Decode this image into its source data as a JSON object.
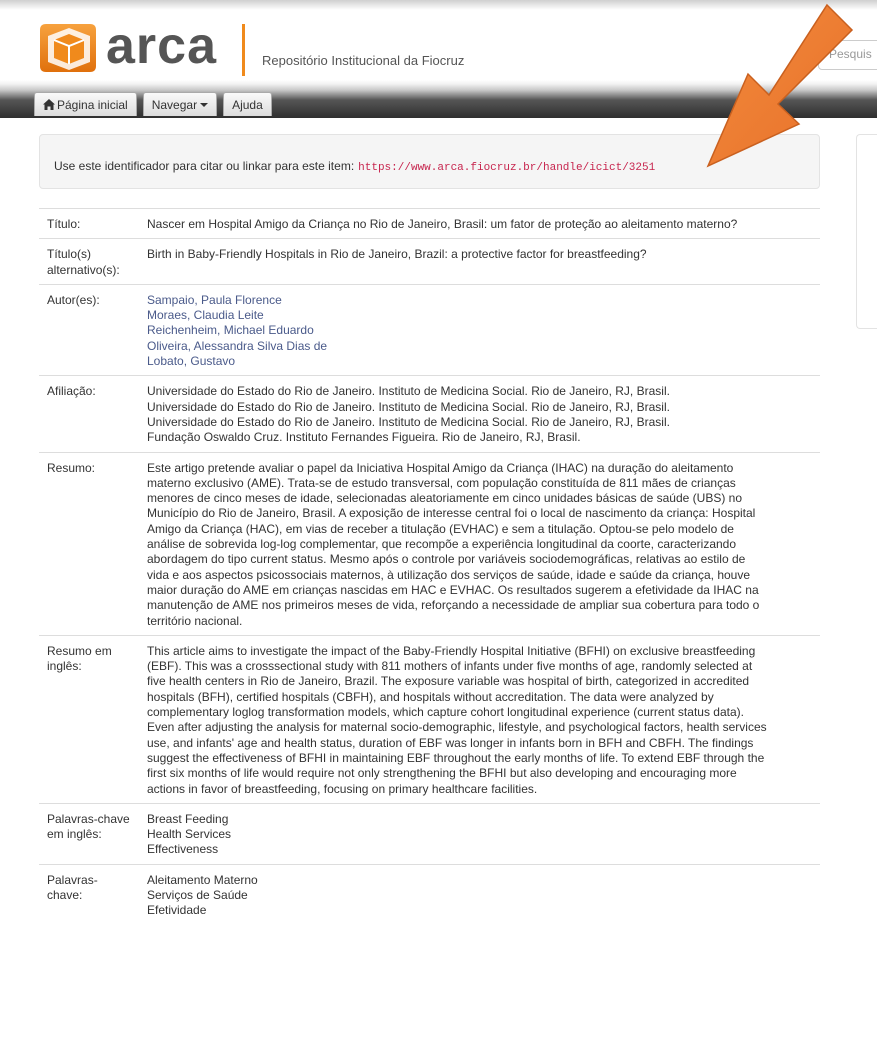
{
  "header": {
    "logo_text": "arca",
    "repo_title": "Repositório Institucional da Fiocruz",
    "search_placeholder_fragment": "Pesquis",
    "colors": {
      "logo_orange": "#f08a1c",
      "logo_grey": "#555555"
    }
  },
  "nav": {
    "items": [
      {
        "label": "Página inicial",
        "icon": "home-icon"
      },
      {
        "label": "Navegar",
        "icon": "caret-down-icon"
      },
      {
        "label": "Ajuda"
      }
    ]
  },
  "cite": {
    "text": "Use este identificador para citar ou linkar para este item:",
    "url": "https://www.arca.fiocruz.br/handle/icict/3251"
  },
  "annotation": {
    "icon": "orange-arrow-icon",
    "color": "#ee7d2e"
  },
  "metadata": [
    {
      "label": "Título:",
      "lines": [
        "Nascer em Hospital Amigo da Criança no Rio de Janeiro, Brasil: um fator de proteção ao aleitamento materno?"
      ]
    },
    {
      "label": "Título(s) alternativo(s):",
      "lines": [
        "Birth in Baby-Friendly Hospitals in Rio de Janeiro, Brazil: a protective factor for breastfeeding?"
      ]
    },
    {
      "label": "Autor(es):",
      "links": true,
      "lines": [
        "Sampaio, Paula Florence",
        "Moraes, Claudia Leite",
        "Reichenheim, Michael Eduardo",
        "Oliveira, Alessandra Silva Dias de",
        "Lobato, Gustavo"
      ]
    },
    {
      "label": "Afiliação:",
      "lines": [
        "Universidade do Estado do Rio de Janeiro. Instituto de Medicina Social. Rio de Janeiro, RJ, Brasil.",
        "Universidade do Estado do Rio de Janeiro. Instituto de Medicina Social. Rio de Janeiro, RJ, Brasil.",
        "Universidade do Estado do Rio de Janeiro. Instituto de Medicina Social. Rio de Janeiro, RJ, Brasil.",
        "Fundação Oswaldo Cruz. Instituto Fernandes Figueira. Rio de Janeiro, RJ, Brasil."
      ]
    },
    {
      "label": "Resumo:",
      "lines": [
        "Este artigo pretende avaliar o papel da Iniciativa Hospital Amigo da Criança (IHAC) na duração do aleitamento",
        "materno exclusivo (AME). Trata-se de estudo transversal, com população constituída de 811 mães de crianças",
        "menores de cinco meses de idade, selecionadas aleatoriamente em cinco unidades básicas de saúde (UBS) no",
        "Município do Rio de Janeiro, Brasil. A exposição de interesse central foi o local de nascimento da criança: Hospital",
        "Amigo da Criança (HAC), em vias de receber a titulação (EVHAC) e sem a titulação. Optou-se pelo modelo de",
        "análise de sobrevida log-log complementar, que recompõe a experiência longitudinal da coorte, caracterizando",
        "abordagem do tipo current status. Mesmo após o controle por variáveis sociodemográficas, relativas ao estilo de",
        "vida e aos aspectos psicossociais maternos, à utilização dos serviços de saúde, idade e saúde da criança, houve",
        "maior duração do AME em crianças nascidas em HAC e EVHAC. Os resultados sugerem a efetividade da IHAC na",
        "manutenção de AME nos primeiros meses de vida, reforçando a necessidade de ampliar sua cobertura para todo o",
        "território nacional."
      ]
    },
    {
      "label": "Resumo em inglês:",
      "lines": [
        "This article aims to investigate the impact of the Baby-Friendly Hospital Initiative (BFHI) on exclusive breastfeeding",
        "(EBF). This was a crosssectional study with 811 mothers of infants under five months of age, randomly selected at",
        "five health centers in Rio de Janeiro, Brazil. The exposure variable was hospital of birth, categorized in accredited",
        "hospitals (BFH), certified hospitals (CBFH), and hospitals without accreditation. The data were analyzed by",
        "complementary loglog transformation models, which capture cohort longitudinal experience (current status data).",
        "Even after adjusting the analysis for maternal socio-demographic, lifestyle, and psychological factors, health services",
        "use, and infants' age and health status, duration of EBF was longer in infants born in BFH and CBFH. The findings",
        "suggest the effectiveness of BFHI in maintaining EBF throughout the early months of life. To extend EBF through the",
        "first six months of life would require not only strengthening the BFHI but also developing and encouraging more",
        "actions in favor of breastfeeding, focusing on primary healthcare facilities."
      ]
    },
    {
      "label": "Palavras-chave em inglês:",
      "lines": [
        "Breast Feeding",
        "Health Services",
        "Effectiveness"
      ]
    },
    {
      "label": "Palavras-chave:",
      "lines": [
        "Aleitamento Materno",
        "Serviços de Saúde",
        "Efetividade"
      ]
    }
  ]
}
